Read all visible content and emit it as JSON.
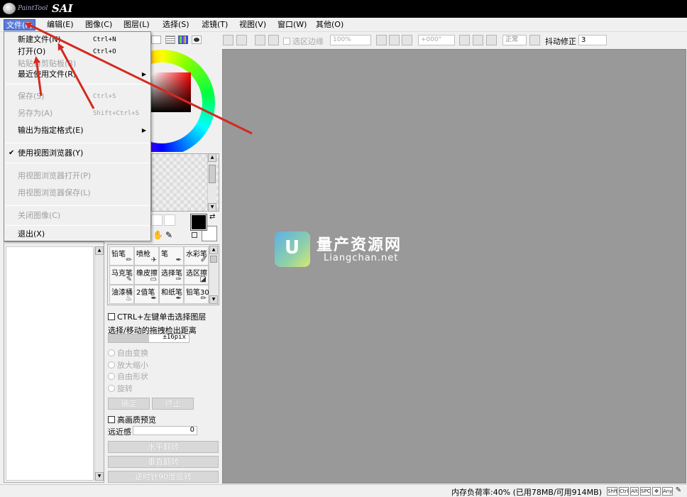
{
  "app": {
    "logo_text": "PaintTool SAI",
    "logo_small": "PaintTool",
    "logo_big": "SAI"
  },
  "menubar": {
    "items": [
      "文件(F)",
      "编辑(E)",
      "图像(C)",
      "图层(L)",
      "选择(S)",
      "滤镜(T)",
      "视图(V)",
      "窗口(W)",
      "其他(O)"
    ]
  },
  "file_menu": {
    "new": {
      "label": "新建文件(N)",
      "shortcut": "Ctrl+N"
    },
    "open": {
      "label": "打开(O)",
      "shortcut": "Ctrl+O"
    },
    "paste_clipboard": {
      "label": "粘贴自剪贴板(B)"
    },
    "recent": {
      "label": "最近使用文件(R)"
    },
    "save": {
      "label": "保存(S)",
      "shortcut": "Ctrl+S"
    },
    "save_as": {
      "label": "另存为(A)",
      "shortcut": "Shift+Ctrl+S"
    },
    "export": {
      "label": "输出为指定格式(E)"
    },
    "use_viewer": {
      "label": "使用视图浏览器(Y)",
      "checked": true
    },
    "viewer_open": {
      "label": "用视图浏览器打开(P)"
    },
    "viewer_save": {
      "label": "用视图浏览器保存(L)"
    },
    "close": {
      "label": "关闭图像(C)"
    },
    "exit": {
      "label": "退出(X)"
    }
  },
  "toolbar": {
    "select_edge": "选区边缘",
    "zoom": "100%",
    "angle": "+000°",
    "mode": "正常",
    "stabilizer_label": "抖动修正",
    "stabilizer_value": "3"
  },
  "tools": {
    "items": [
      {
        "name": "铅笔",
        "icon": "pencil-icon"
      },
      {
        "name": "喷枪",
        "icon": "airbrush-icon"
      },
      {
        "name": "笔",
        "icon": "pen-icon"
      },
      {
        "name": "水彩笔",
        "icon": "watercolor-icon"
      },
      {
        "name": "马克笔",
        "icon": "marker-icon"
      },
      {
        "name": "橡皮擦",
        "icon": "eraser-icon"
      },
      {
        "name": "选择笔",
        "icon": "select-pen-icon"
      },
      {
        "name": "选区擦",
        "icon": "select-eraser-icon"
      },
      {
        "name": "油漆桶",
        "icon": "bucket-icon"
      },
      {
        "name": "2值笔",
        "icon": "binary-pen-icon"
      },
      {
        "name": "和纸笔",
        "icon": "washi-pen-icon"
      },
      {
        "name": "铅笔30",
        "icon": "pencil-icon"
      }
    ]
  },
  "options": {
    "ctrl_select_layer": "CTRL+左键单击选择图层",
    "drag_distance_label": "选择/移动的拖拽检出距离",
    "drag_distance_value": "±16pix",
    "free_transform": "自由变换",
    "scale": "放大缩小",
    "free_shape": "自由形状",
    "rotate": "旋转",
    "confirm": "确定",
    "cancel": "终止",
    "hq_preview": "高画质预览",
    "perspective_label": "远近感",
    "perspective_value": "0",
    "flip_h": "水平翻转",
    "flip_v": "垂直翻转",
    "rotate_ccw": "逆时针90度旋转"
  },
  "watermark": {
    "badge": "U",
    "title": "量产资源网",
    "url": "Liangchan.net"
  },
  "statusbar": {
    "memory": "内存负荷率:40% (已用78MB/可用914MB)",
    "keys": [
      "Shft",
      "Ctrl",
      "Alt",
      "SPC",
      "Any"
    ]
  },
  "colors": {
    "menu_highlight": "#5b7cd9",
    "arrow": "#d42a1e",
    "canvas_bg": "#999999"
  }
}
